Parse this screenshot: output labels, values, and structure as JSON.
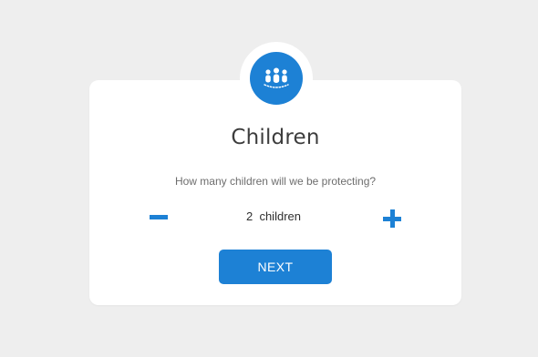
{
  "card": {
    "icon": "children-group-icon",
    "title": "Children",
    "question": "How many children will we be protecting?"
  },
  "stepper": {
    "decrement_icon": "minus-icon",
    "increment_icon": "plus-icon",
    "value": 2,
    "display": "2  children"
  },
  "actions": {
    "next_label": "NEXT"
  },
  "colors": {
    "accent": "#1d81d5",
    "background": "#eeeeee",
    "card": "#ffffff",
    "title_text": "#3d3d3d"
  }
}
